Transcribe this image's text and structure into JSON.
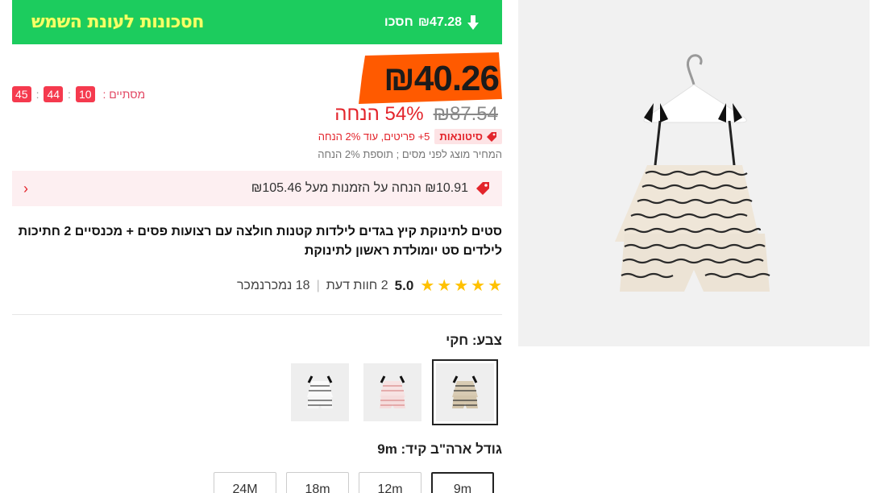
{
  "banner": {
    "save_amount": "₪47.28",
    "save_label": "חסכו",
    "title": "חסכונות לעונת השמש"
  },
  "countdown": {
    "label": "מסתיים :",
    "hours": "10",
    "minutes": "44",
    "seconds": "45",
    "separator": ":"
  },
  "price": {
    "current": "₪40.26",
    "original": "₪87.54",
    "discount": "54% הנחה"
  },
  "wholesale": {
    "badge": "סיטונאות",
    "text": "5+ פריטים, עוד 2% הנחה"
  },
  "tax_note": "המחיר מוצג לפני מסים ; תוספת 2% הנחה",
  "coupon": {
    "text": "₪10.91 הנחה על הזמנות מעל ₪105.46"
  },
  "product": {
    "title": "סטים לתינוקת קיץ בגדים לילדות קטנות חולצה עם רצועות פסים + מכנסיים 2 חתיכות לילדים סט יומולדת ראשון לתינוקת"
  },
  "rating": {
    "value": "5.0",
    "stars": 5,
    "reviews": "2 חוות דעת",
    "separator": "|",
    "sold": "18 נמכרנמכר"
  },
  "color": {
    "label": "צבע: חקי",
    "options": [
      {
        "name": "khaki",
        "selected": true
      },
      {
        "name": "pink",
        "selected": false
      },
      {
        "name": "white",
        "selected": false
      }
    ]
  },
  "size": {
    "label": "גודל ארה\"ב קיד: 9m",
    "options": [
      "9m",
      "12m",
      "18m",
      "24M"
    ],
    "selected": "9m"
  },
  "colors": {
    "banner_green": "#1ccc5e",
    "banner_title": "#f5ff6a",
    "price_blob": "#ff5a00",
    "accent_red": "#e3242b",
    "countdown_box": "#f53a4e",
    "star": "#ffc100"
  }
}
